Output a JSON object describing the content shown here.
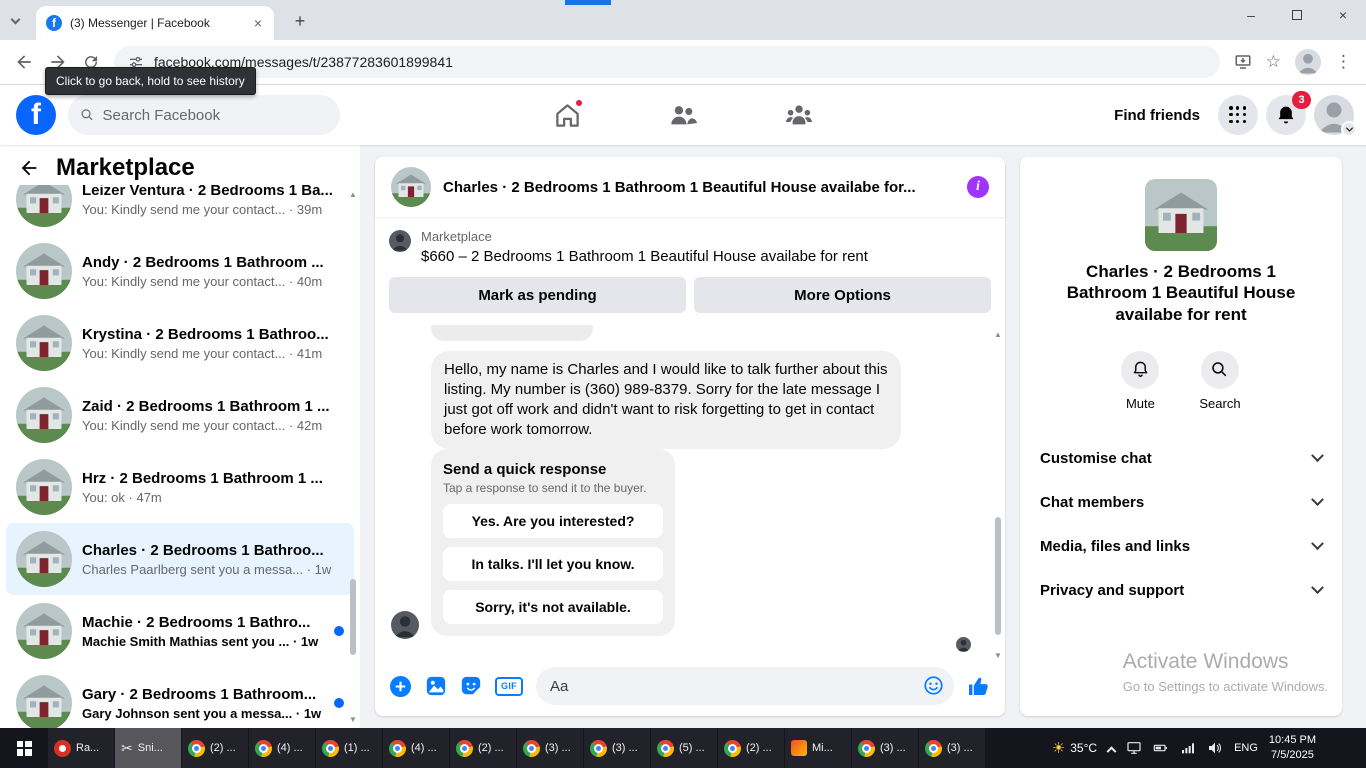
{
  "browser": {
    "tab_title": "(3) Messenger | Facebook",
    "url": "facebook.com/messages/t/23877283601899841",
    "tooltip": "Click to go back, hold to see history"
  },
  "facebook_header": {
    "search_placeholder": "Search Facebook",
    "find_friends_label": "Find friends",
    "notification_badge": "3"
  },
  "sidebar": {
    "title": "Marketplace",
    "conversations": [
      {
        "name": "Leizer Ventura · 2 Bedrooms 1 Ba...",
        "preview": "You: Kindly send me your contact...",
        "time": "39m"
      },
      {
        "name": "Andy · 2 Bedrooms 1 Bathroom ...",
        "preview": "You: Kindly send me your contact...",
        "time": "40m"
      },
      {
        "name": "Krystina · 2 Bedrooms 1 Bathroo...",
        "preview": "You: Kindly send me your contact...",
        "time": "41m"
      },
      {
        "name": "Zaid · 2 Bedrooms 1 Bathroom 1 ...",
        "preview": "You: Kindly send me your contact...",
        "time": "42m"
      },
      {
        "name": "Hrz · 2 Bedrooms 1 Bathroom 1 ...",
        "preview": "You: ok",
        "time": "47m"
      },
      {
        "name": "Charles · 2 Bedrooms 1 Bathroo...",
        "preview": "Charles Paarlberg sent you a messa...",
        "time": "1w"
      },
      {
        "name": "Machie · 2 Bedrooms 1 Bathro...",
        "preview": "Machie Smith Mathias sent you ...",
        "time": "1w"
      },
      {
        "name": "Gary · 2 Bedrooms 1 Bathroom...",
        "preview": "Gary Johnson sent you a messa...",
        "time": "1w"
      }
    ]
  },
  "chat": {
    "header_title": "Charles · 2 Bedrooms 1 Bathroom 1 Beautiful House availabe for...",
    "context": {
      "label": "Marketplace",
      "detail": "$660 – 2 Bedrooms 1 Bathroom 1 Beautiful House availabe for rent"
    },
    "buttons": {
      "mark_as_pending": "Mark as pending",
      "more_options": "More Options"
    },
    "message": "Hello, my name is Charles and I would like to talk further about this listing. My number is (360) 989-8379. Sorry for the late message I just got off work and didn't want to risk forgetting to get in contact before work tomorrow.",
    "quick_response": {
      "title": "Send a quick response",
      "subtitle": "Tap a response to send it to the buyer.",
      "options": [
        "Yes. Are you interested?",
        "In talks. I'll let you know.",
        "Sorry, it's not available."
      ]
    },
    "composer": {
      "placeholder": "Aa",
      "gif_label": "GIF"
    }
  },
  "details_panel": {
    "title": "Charles · 2 Bedrooms 1 Bathroom 1 Beautiful House availabe for rent",
    "mute_label": "Mute",
    "search_label": "Search",
    "sections": [
      "Customise chat",
      "Chat members",
      "Media, files and links",
      "Privacy and support"
    ],
    "watermark_line1": "Activate Windows",
    "watermark_line2": "Go to Settings to activate Windows."
  },
  "taskbar": {
    "items": [
      {
        "label": "Ra..."
      },
      {
        "label": "Sni..."
      },
      {
        "label": "(2) ..."
      },
      {
        "label": "(4) ..."
      },
      {
        "label": "(1) ..."
      },
      {
        "label": "(4) ..."
      },
      {
        "label": "(2) ..."
      },
      {
        "label": "(3) ..."
      },
      {
        "label": "(3) ..."
      },
      {
        "label": "(5) ..."
      },
      {
        "label": "(2) ..."
      },
      {
        "label": "Mi..."
      },
      {
        "label": "(3) ..."
      },
      {
        "label": "(3) ..."
      }
    ],
    "tray": {
      "temperature": "35°C",
      "language": "ENG",
      "time": "10:45 PM",
      "date": "7/5/2025"
    }
  },
  "colors": {
    "facebook_blue": "#0866ff",
    "messenger_blue": "#0a7cff",
    "info_icon_purple": "#a033ff",
    "badge_red": "#e41e3f",
    "selected_conversation": "#e7f3ff"
  }
}
